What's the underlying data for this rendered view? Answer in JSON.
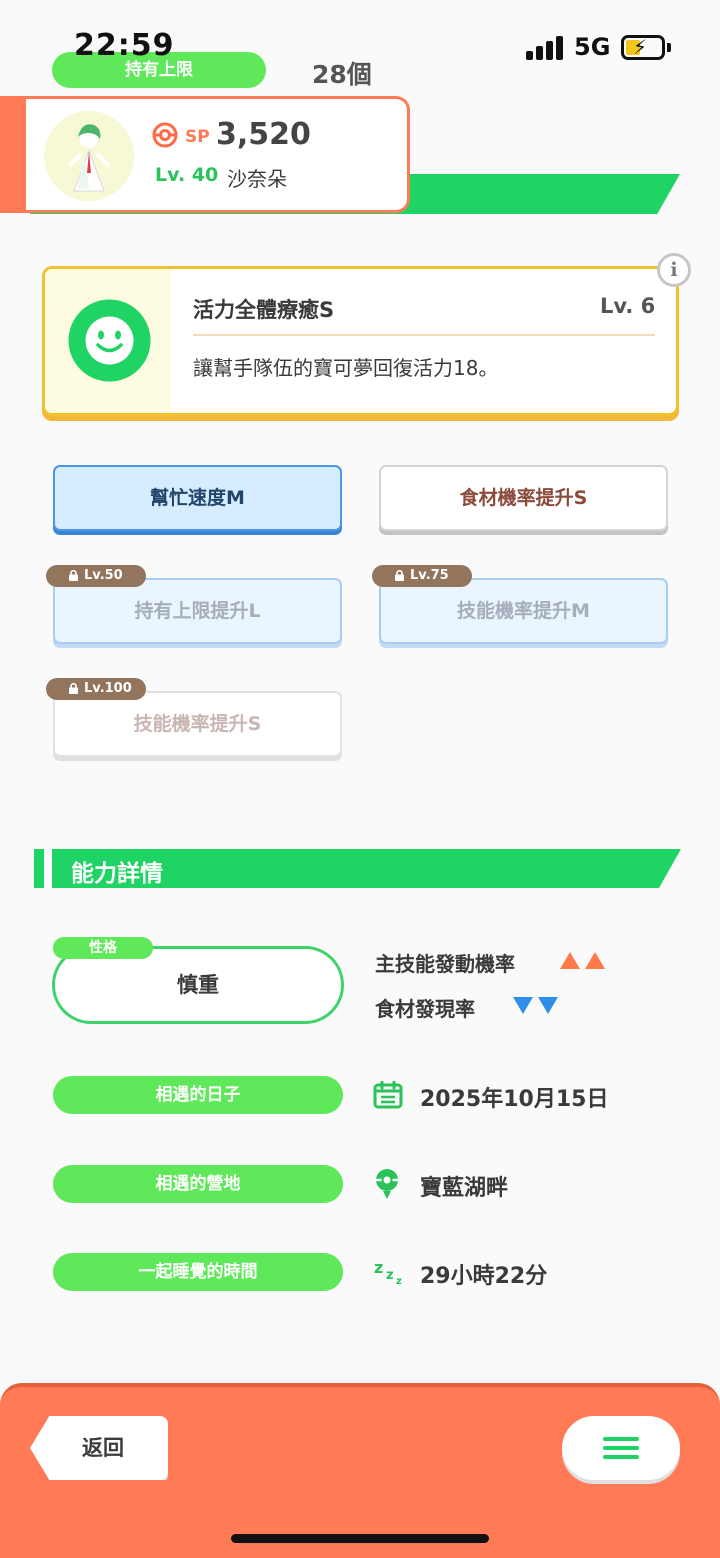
{
  "status_bar": {
    "time": "22:59",
    "network": "5G"
  },
  "capacity": {
    "label": "持有上限",
    "count": "28個"
  },
  "pokemon": {
    "sp_label": "SP",
    "sp_value": "3,520",
    "level_label": "Lv. 40",
    "name": "沙奈朵"
  },
  "main_skill": {
    "name": "活力全體療癒S",
    "level": "Lv. 6",
    "description": "讓幫手隊伍的寶可夢回復活力18。",
    "info_glyph": "i"
  },
  "sub_skills": [
    {
      "label": "幫忙速度M",
      "state": "active"
    },
    {
      "label": "食材機率提升S",
      "state": "unlocked"
    },
    {
      "label": "持有上限提升L",
      "state": "locked",
      "unlock_level": "Lv.50"
    },
    {
      "label": "技能機率提升M",
      "state": "locked",
      "unlock_level": "Lv.75"
    },
    {
      "label": "技能機率提升S",
      "state": "locked",
      "unlock_level": "Lv.100"
    }
  ],
  "details": {
    "section_title": "能力詳情",
    "nature_tag": "性格",
    "nature": "慎重",
    "nature_up": "主技能發動機率",
    "nature_down": "食材發現率",
    "met_date_label": "相遇的日子",
    "met_date": "2025年10月15日",
    "met_place_label": "相遇的營地",
    "met_place": "寶藍湖畔",
    "sleep_time_label": "一起睡覺的時間",
    "sleep_time": "29小時22分"
  },
  "footer": {
    "back_label": "返回"
  },
  "colors": {
    "accent_green": "#1fd364",
    "pill_green": "#5fe85a",
    "footer_orange": "#ff7a55",
    "skill_gold": "#f2c12e",
    "up_arrow": "#ff7a4a",
    "down_arrow": "#2f8fe8"
  },
  "icons": [
    "signal-icon",
    "battery-charging-icon",
    "sp-icon",
    "smiley-skill-icon",
    "info-icon",
    "lock-icon",
    "calendar-icon",
    "location-pin-icon",
    "sleep-zzz-icon",
    "hamburger-menu-icon"
  ]
}
